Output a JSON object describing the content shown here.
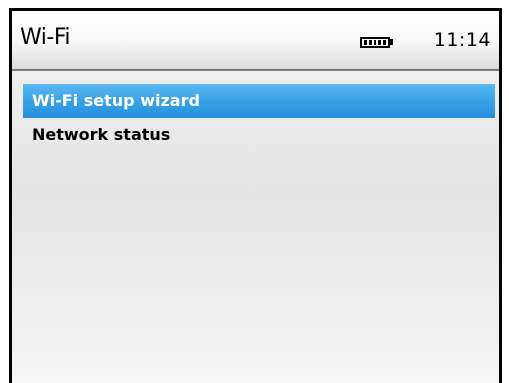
{
  "header": {
    "title": "Wi-Fi",
    "battery_icon": "battery-full-icon",
    "time": "11:14"
  },
  "menu": {
    "items": [
      {
        "label": "Wi-Fi setup wizard",
        "selected": true
      },
      {
        "label": "Network status",
        "selected": false
      }
    ]
  },
  "colors": {
    "selection": "#38a2e8",
    "frame": "#000000"
  }
}
